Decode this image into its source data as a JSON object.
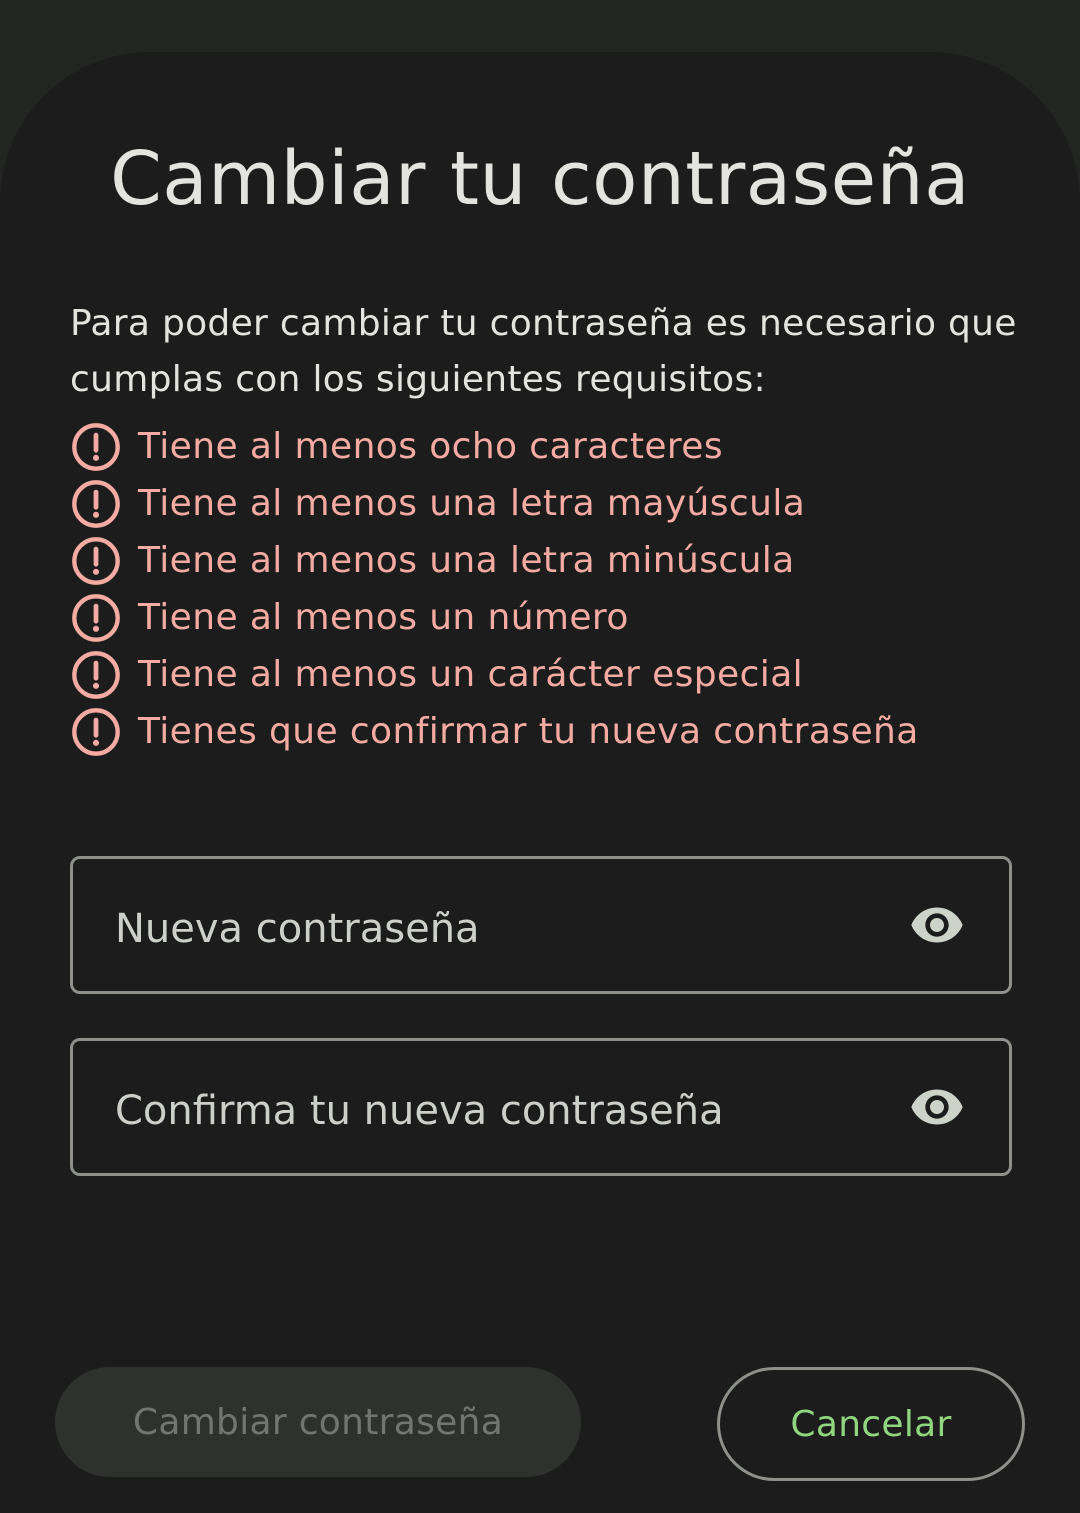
{
  "dialog": {
    "title": "Cambiar tu contraseña",
    "description": "Para poder cambiar tu contraseña es necesario que cumplas con los siguientes requisitos:",
    "requirements": [
      {
        "icon": "alert-circle-icon",
        "text": "Tiene al menos ocho caracteres"
      },
      {
        "icon": "alert-circle-icon",
        "text": "Tiene al menos una letra mayúscula"
      },
      {
        "icon": "alert-circle-icon",
        "text": "Tiene al menos una letra minúscula"
      },
      {
        "icon": "alert-circle-icon",
        "text": "Tiene al menos un número"
      },
      {
        "icon": "alert-circle-icon",
        "text": "Tiene al menos un carácter especial"
      },
      {
        "icon": "alert-circle-icon",
        "text": "Tienes que confirmar tu nueva contraseña"
      }
    ],
    "fields": {
      "new_password": {
        "value": "",
        "placeholder": "Nueva contraseña",
        "toggle_icon": "eye-icon"
      },
      "confirm_password": {
        "value": "",
        "placeholder": "Confirma tu nueva contraseña",
        "toggle_icon": "eye-icon"
      }
    },
    "buttons": {
      "submit_label": "Cambiar contraseña",
      "cancel_label": "Cancelar"
    }
  },
  "colors": {
    "background": "#1b1c1b",
    "title_text": "#e3e4df",
    "error": "#f5aba1",
    "accent": "#90d67e",
    "disabled_button_bg": "#2f312f",
    "disabled_button_text": "#727571",
    "outline": "#8e908c"
  }
}
